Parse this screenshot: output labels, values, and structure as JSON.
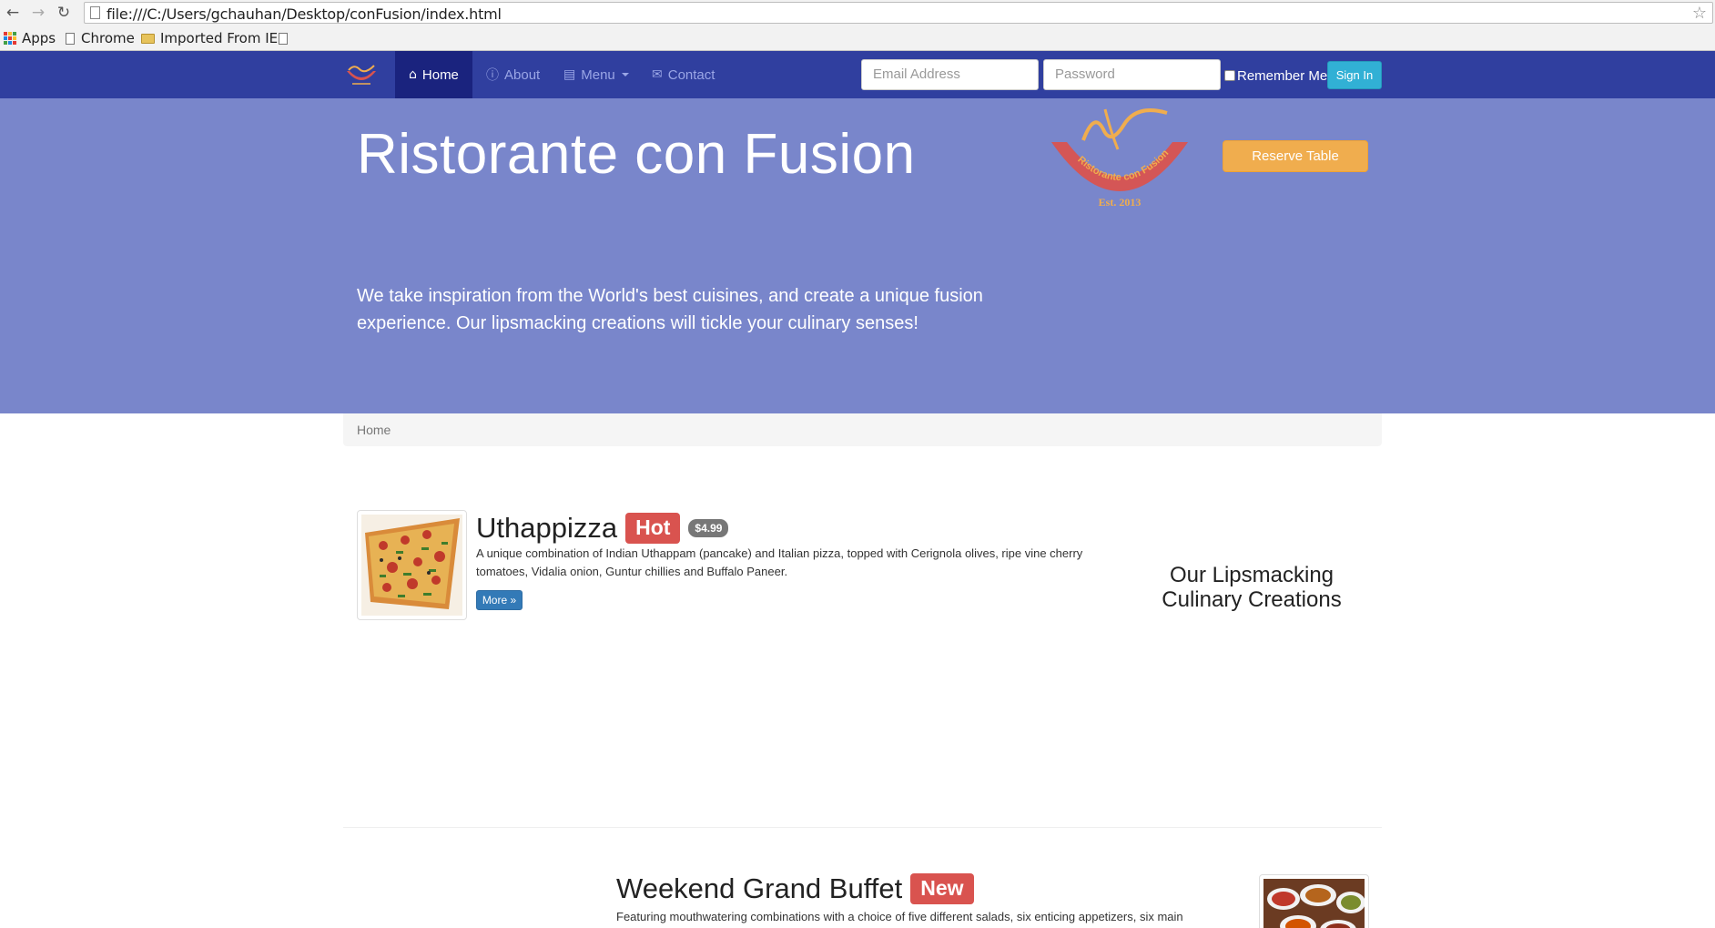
{
  "browser": {
    "url": "file:///C:/Users/gchauhan/Desktop/conFusion/index.html",
    "bookmarks": [
      {
        "label": "Apps"
      },
      {
        "label": "Chrome"
      },
      {
        "label": "Imported From IE"
      }
    ]
  },
  "navbar": {
    "items": [
      {
        "label": "Home",
        "icon": "home-icon",
        "active": true
      },
      {
        "label": "About",
        "icon": "info-icon"
      },
      {
        "label": "Menu",
        "icon": "list-icon"
      },
      {
        "label": "Contact",
        "icon": "envelope-icon"
      }
    ],
    "email_placeholder": "Email Address",
    "password_placeholder": "Password",
    "remember_label": "Remember Me",
    "signin_label": "Sign In",
    "colors": {
      "bar": "#303f9f",
      "active": "#1a237e"
    }
  },
  "jumbotron": {
    "title": "Ristorante con Fusion",
    "tagline": "We take inspiration from the World's best cuisines, and create a unique fusion experience. Our lipsmacking creations will tickle your culinary senses!",
    "reserve_label": "Reserve Table",
    "logo_text": "Ristorante con Fusion",
    "logo_est": "Est. 2013",
    "background": "#7986cb"
  },
  "breadcrumb": {
    "current": "Home"
  },
  "featured": {
    "title": "Uthappizza",
    "label": "Hot",
    "price": "$4.99",
    "description": "A unique combination of Indian Uthappam (pancake) and Italian pizza, topped with Cerignola olives, ripe vine cherry tomatoes, Vidalia onion, Guntur chillies and Buffalo Paneer.",
    "more_label": "More »"
  },
  "side_heading": "Our Lipsmacking Culinary Creations",
  "promotion": {
    "title": "Weekend Grand Buffet",
    "label": "New",
    "description": "Featuring mouthwatering combinations with a choice of five different salads, six enticing appetizers, six main"
  }
}
